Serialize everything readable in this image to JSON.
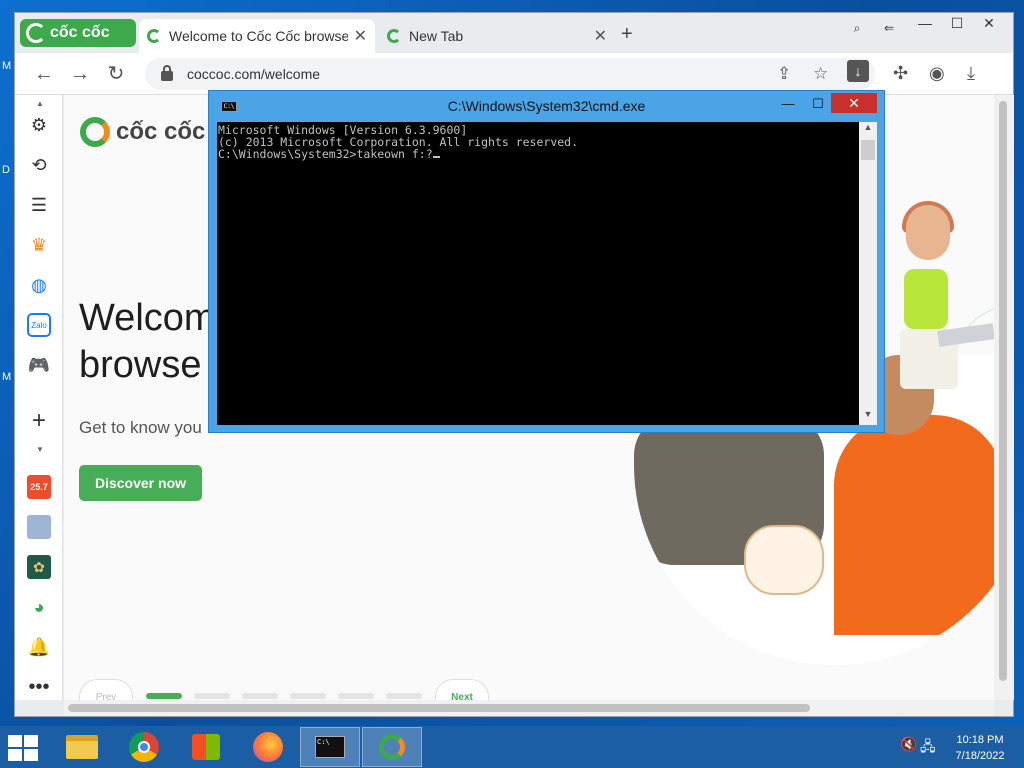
{
  "desktop": {
    "edge_letters": [
      "M",
      "D",
      "M"
    ]
  },
  "browser": {
    "brand_name": "cốc cốc",
    "tabs": [
      {
        "label": "Welcome to Cốc Cốc browser",
        "active": true
      },
      {
        "label": "New Tab",
        "active": false
      }
    ],
    "new_tab_symbol": "+",
    "url": "coccoc.com/welcome",
    "window_controls": {
      "minimize": "—",
      "maximize": "☐",
      "close": "✕"
    }
  },
  "page": {
    "logo_text": "cốc cốc",
    "hero_line1": "Welcom",
    "hero_line2": "browse",
    "subtitle": "Get to know you",
    "cta": "Discover now",
    "pager": {
      "prev": "Prev",
      "next": "Next",
      "dash_count": 6,
      "active_index": 0
    },
    "accent": "#48ad57"
  },
  "cmd": {
    "icon_text": "C:\\",
    "title": "C:\\Windows\\System32\\cmd.exe",
    "lines": [
      "Microsoft Windows [Version 6.3.9600]",
      "(c) 2013 Microsoft Corporation. All rights reserved.",
      "",
      "C:\\Windows\\System32>takeown f:?"
    ],
    "controls": {
      "minimize": "—",
      "maximize": "☐",
      "close": "✕"
    }
  },
  "sidebar": {
    "icons": [
      "gear-icon",
      "history-icon",
      "notes-icon",
      "crown-icon",
      "messenger-icon",
      "zalo-icon",
      "gamepad-icon",
      "plus-icon",
      "shopee-icon",
      "anime-icon",
      "lotus-icon",
      "coccoc-badge-icon",
      "bell-icon",
      "more-icon"
    ],
    "zalo_label": "Zalo",
    "shopee_label": "25.7"
  },
  "taskbar": {
    "apps": [
      "file-explorer",
      "chrome",
      "windows-update",
      "firefox",
      "cmd",
      "coccoc"
    ],
    "active_apps": [
      "cmd",
      "coccoc"
    ],
    "time": "10:18 PM",
    "date": "7/18/2022"
  }
}
